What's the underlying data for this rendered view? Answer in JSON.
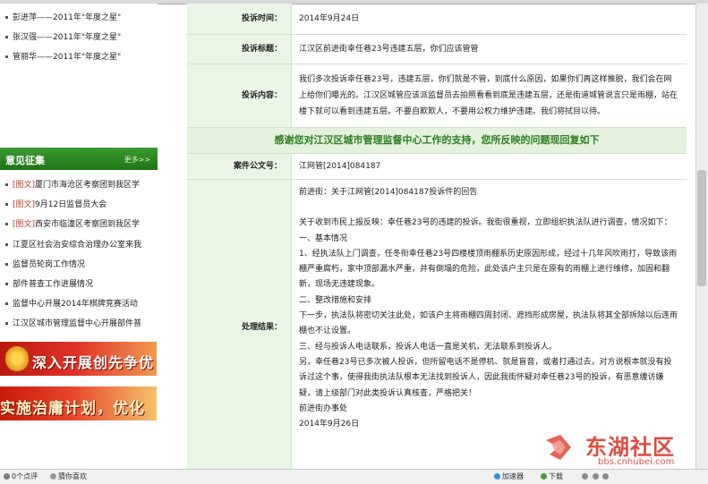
{
  "sidebar": {
    "stars": [
      "彭进萍——2011年\"年度之星\"",
      "张汉强——2011年\"年度之星\"",
      "管丽华——2011年\"年度之星\""
    ],
    "opinion": {
      "title": "意见征集",
      "more": "更多>>",
      "items": [
        {
          "tag": "[图文]",
          "text": "厦门市海沧区考察团到我区学"
        },
        {
          "tag": "[图文]",
          "text": "9月12日监督员大会"
        },
        {
          "tag": "[图文]",
          "text": "西安市临潼区考察团到我区学"
        },
        {
          "tag": "",
          "text": "江夏区社会治安综合治理办公室来我"
        },
        {
          "tag": "",
          "text": "监督员轮岗工作情况"
        },
        {
          "tag": "",
          "text": "部件普查工作进展情况"
        },
        {
          "tag": "",
          "text": "监督中心开展2014年棋牌竞赛活动"
        },
        {
          "tag": "",
          "text": "江汉区城市管理监督中心开展部件普"
        }
      ]
    },
    "banners": [
      "深入开展创先争优活动",
      "实施治庸计划，优化发展环境"
    ]
  },
  "main": {
    "time": {
      "label": "投诉时间：",
      "value": "2014年9月24日"
    },
    "title": {
      "label": "投诉标题：",
      "value": "江汉区前进街幸任巷23号违建五层，你们应该管管"
    },
    "content": {
      "label": "投诉内容：",
      "value": "我们多次投诉幸任巷23号，违建五层，你们就是不管，到底什么原因，如果你们再这样推脱，我们会在网上给你们曝光的。江汉区城管应该派监督员去拍照看看到底是违建五层，还是街道城管说言只是雨棚，站在楼下就可以看到违建五层。不要自欺欺人，不要用公权力维护违建。我们将拭目以待。"
    },
    "thanks": "感谢您对江汉区城市管理监督中心工作的支持，您所反映的问题现回复如下",
    "case": {
      "label": "案件公文号：",
      "value": "江网管[2014]084187"
    },
    "result": {
      "label": "处理结果：",
      "lines": [
        "前进街：关于江网管[2014]084187投诉件的回告",
        "",
        "关于收到市民上报反映：幸任巷23号的违建的投诉。我街很重视，立即组织执法队进行调查，情况如下：",
        "一、基本情况",
        "1、经执法队上门调查，任冬衔幸任巷23号四楼楼顶雨棚系历史原因形成，经过十几年风吹雨打，导致该雨棚严重腐朽，家中顶部漏水严重，并有倒塌的危险，此处该户主只是在原有的雨棚上进行维修，加固和翻新，现场无违建现象。",
        "二、整改措施和安排",
        "下一步，执法队将密切关注此处，如该户主将雨棚四周封闭、遮挡形成房屋，执法队将其全部拆除以后连雨棚也不让设置。",
        "三、经与投诉人电话联系，投诉人电话一直是关机，无法联系到投诉人。",
        "另，幸任巷23号已多次被人投诉，但所留电话不是停机、就是盲音，或者打通过去，对方说根本就没有投诉过这个事，使得我街执法队根本无法找到投诉人，因此我街怀疑对幸任巷23号的投诉，有恶意缠访嫌疑，请上级部门对此类投诉认真核查，严格把关！",
        "前进街办事处",
        "2014年9月26日"
      ]
    }
  },
  "watermark": {
    "name": "东湖社区",
    "url": "bbs.cnhubei.com"
  },
  "statusbar": {
    "comments": "0个点评",
    "like": "猜你喜欢",
    "accelerator": "加速器",
    "download": "下载"
  },
  "colors": {
    "green_header": "#2a8a1f",
    "label_bg": "#eaf5e6",
    "thanks_text": "#2e7d25",
    "watermark": "#d93a2c"
  }
}
